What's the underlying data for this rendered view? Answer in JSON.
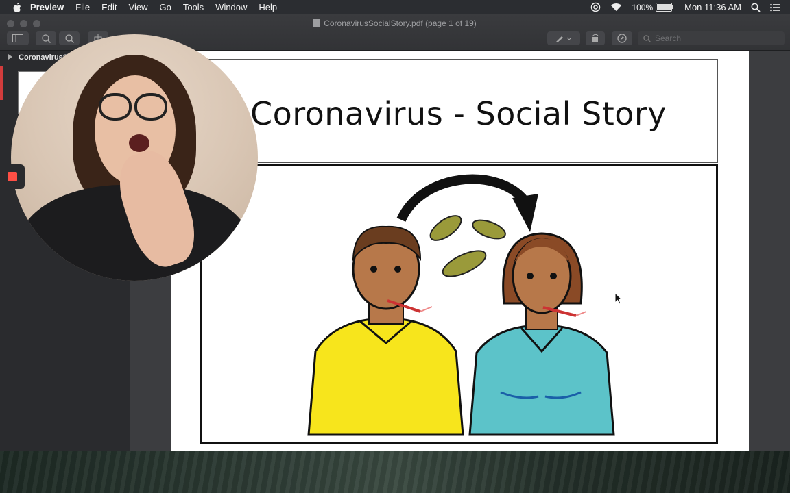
{
  "menubar": {
    "app_name": "Preview",
    "menus": [
      "File",
      "Edit",
      "View",
      "Go",
      "Tools",
      "Window",
      "Help"
    ],
    "battery_text": "100%",
    "clock": "Mon 11:36 AM",
    "icons": [
      "apple-icon",
      "creative-cloud-icon",
      "wifi-icon",
      "battery-icon",
      "spotlight-search-icon",
      "notification-center-icon"
    ]
  },
  "window": {
    "title": "CoronavirusSocialStory.pdf (page 1 of 19)",
    "search_placeholder": "Search"
  },
  "sidebar": {
    "item_label": "CoronavirusS"
  },
  "document": {
    "heading": "Coronavirus - Social Story"
  },
  "colors": {
    "shirt_yellow": "#f7e51c",
    "shirt_teal": "#5cc3c9",
    "germ_olive": "#9a9a3a",
    "record_red": "#ff4f45"
  }
}
